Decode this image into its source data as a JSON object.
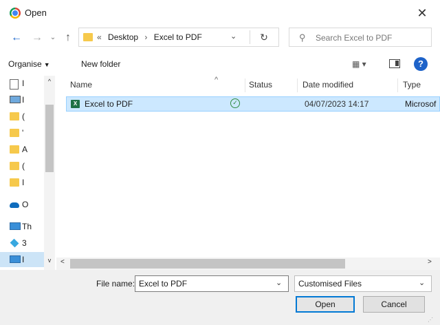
{
  "window": {
    "title": "Open",
    "close_glyph": "✕"
  },
  "nav": {
    "back_glyph": "←",
    "forward_glyph": "→",
    "recent_glyph": "⌄",
    "up_glyph": "↑"
  },
  "address": {
    "prefix": "«",
    "parts": [
      "Desktop",
      "Excel to PDF"
    ],
    "separator": "›",
    "dropdown_glyph": "⌄",
    "refresh_glyph": "↻"
  },
  "search": {
    "placeholder": "Search Excel to PDF"
  },
  "toolbar": {
    "organise_label": "Organise",
    "new_folder_label": "New folder",
    "view_glyph": "▦ ▾",
    "help_glyph": "?"
  },
  "nav_pane": {
    "items": [
      {
        "label": "I",
        "icon": "document-icon"
      },
      {
        "label": "I",
        "icon": "picture-icon"
      },
      {
        "label": "(",
        "icon": "folder-icon"
      },
      {
        "label": "'",
        "icon": "folder-icon"
      },
      {
        "label": "A",
        "icon": "folder-icon"
      },
      {
        "label": "(",
        "icon": "folder-icon"
      },
      {
        "label": "I",
        "icon": "folder-icon"
      },
      {
        "label": "O",
        "icon": "onedrive-icon"
      },
      {
        "label": "Th",
        "icon": "this-pc-icon"
      },
      {
        "label": "3",
        "icon": "3d-objects-icon"
      },
      {
        "label": "I",
        "icon": "desktop-icon"
      }
    ],
    "scroll_up_glyph": "^",
    "scroll_down_glyph": "v"
  },
  "columns": {
    "name": "Name",
    "status": "Status",
    "date_modified": "Date modified",
    "type": "Type",
    "sort_glyph": "^"
  },
  "files": [
    {
      "name": "Excel to PDF",
      "status": "✓",
      "date_modified": "04/07/2023 14:17",
      "type": "Microsof",
      "icon": "excel-icon",
      "icon_letter": "X"
    }
  ],
  "hscroll": {
    "left_glyph": "<",
    "right_glyph": ">"
  },
  "footer": {
    "file_name_label": "File name:",
    "file_name_value": "Excel to PDF",
    "file_type_value": "Customised Files",
    "dropdown_glyph": "⌄",
    "open_label": "Open",
    "cancel_label": "Cancel",
    "grip_glyph": "⋰"
  },
  "colors": {
    "accent": "#0078d4",
    "selection": "#cce8ff",
    "folder": "#f6c94c",
    "excel": "#1d7044"
  }
}
